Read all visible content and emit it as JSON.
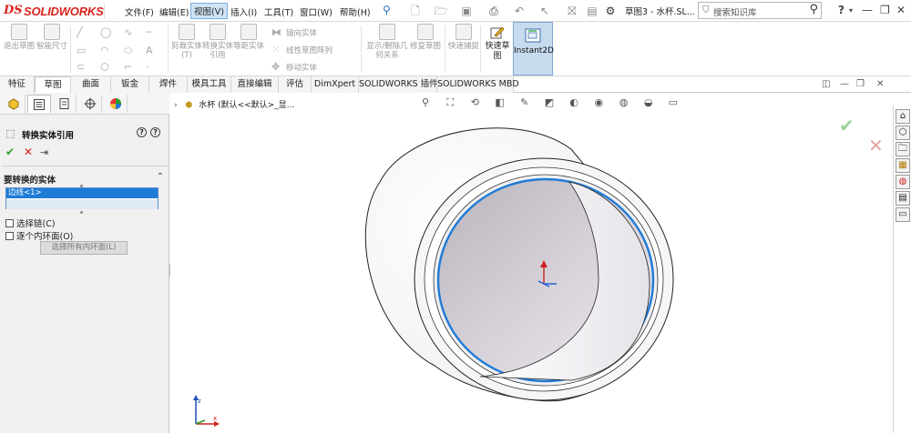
{
  "app": {
    "logo_ds": "DS",
    "logo_text": "SOLIDWORKS",
    "document_title": "草图3 - 水杯.SL...",
    "search_placeholder": "搜索知识库"
  },
  "menu": [
    {
      "label": "文件(F)"
    },
    {
      "label": "编辑(E)"
    },
    {
      "label": "视图(V)"
    },
    {
      "label": "插入(I)"
    },
    {
      "label": "工具(T)"
    },
    {
      "label": "窗口(W)"
    },
    {
      "label": "帮助(H)"
    }
  ],
  "commands": {
    "exit_sketch": "退出草图",
    "smart_dim": "智能尺寸",
    "trim": "剪裁实体(T)",
    "convert": "转换实体引用",
    "offset": "等距实体",
    "mirror": "镜向实体",
    "linear_pattern": "线性草图阵列",
    "move": "移动实体",
    "display_delete": "显示/删除几何关系",
    "repair": "修复草图",
    "rapid_snap": "快速捕捉",
    "quick_sketch": "快速草图",
    "instant2d": "Instant2D"
  },
  "tabs": [
    {
      "label": "特征"
    },
    {
      "label": "草图"
    },
    {
      "label": "曲面"
    },
    {
      "label": "钣金"
    },
    {
      "label": "焊件"
    },
    {
      "label": "模具工具"
    },
    {
      "label": "直接编辑"
    },
    {
      "label": "评估"
    },
    {
      "label": "DimXpert"
    },
    {
      "label": "SOLIDWORKS 插件"
    },
    {
      "label": "SOLIDWORKS MBD"
    }
  ],
  "property_manager": {
    "title": "转换实体引用",
    "help": "?",
    "section_title": "要转换的实体",
    "selected_entity": "边线<1>",
    "option_chain": "选择链(C)",
    "option_inner": "逐个内环面(O)",
    "select_all_button": "选择所有内环面(L)"
  },
  "viewport": {
    "crumb": "水杯  (默认<<默认>_显..."
  },
  "colors": {
    "accent": "#1e7bd6",
    "brand_red": "#d8231f",
    "active_tab_bg": "#c7dbef",
    "ok_green": "#2a9b28",
    "cancel_red": "#d02020"
  }
}
